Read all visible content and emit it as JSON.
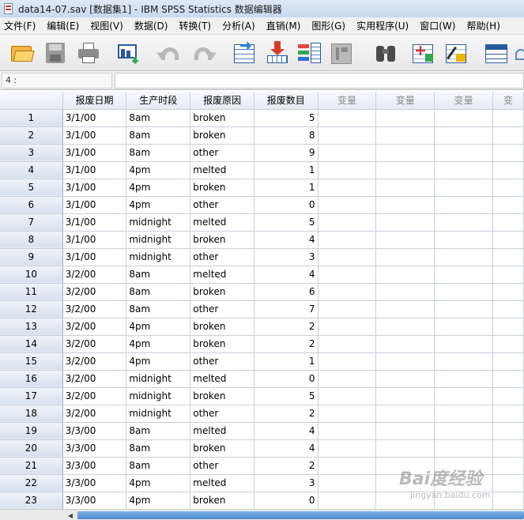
{
  "window": {
    "title": "data14-07.sav [数据集1] - IBM SPSS Statistics 数据编辑器"
  },
  "menu": [
    "文件(F)",
    "编辑(E)",
    "视图(V)",
    "数据(D)",
    "转换(T)",
    "分析(A)",
    "直销(M)",
    "图形(G)",
    "实用程序(U)",
    "窗口(W)",
    "帮助(H)"
  ],
  "toolbar": {
    "buttons": [
      "open-icon",
      "save-icon",
      "print-icon",
      "dialog-recall-icon",
      "undo-icon",
      "redo-icon",
      "goto-case-icon",
      "goto-variable-icon",
      "variables-icon",
      "run-descriptives-icon",
      "find-icon",
      "insert-cases-icon",
      "split-file-icon",
      "value-labels-icon",
      "weight-icon"
    ]
  },
  "cellbar": {
    "reference": "4 :",
    "value": ""
  },
  "grid": {
    "columns": [
      "报废日期",
      "生产时段",
      "报废原因",
      "报废数目",
      "变量",
      "变量",
      "变量",
      "变"
    ],
    "rows": [
      {
        "n": "1",
        "date": "3/1/00",
        "period": "8am",
        "reason": "broken",
        "count": "5"
      },
      {
        "n": "2",
        "date": "3/1/00",
        "period": "8am",
        "reason": "broken",
        "count": "8"
      },
      {
        "n": "3",
        "date": "3/1/00",
        "period": "8am",
        "reason": "other",
        "count": "9"
      },
      {
        "n": "4",
        "date": "3/1/00",
        "period": "4pm",
        "reason": "melted",
        "count": "1"
      },
      {
        "n": "5",
        "date": "3/1/00",
        "period": "4pm",
        "reason": "broken",
        "count": "1"
      },
      {
        "n": "6",
        "date": "3/1/00",
        "period": "4pm",
        "reason": "other",
        "count": "0"
      },
      {
        "n": "7",
        "date": "3/1/00",
        "period": "midnight",
        "reason": "melted",
        "count": "5"
      },
      {
        "n": "8",
        "date": "3/1/00",
        "period": "midnight",
        "reason": "broken",
        "count": "4"
      },
      {
        "n": "9",
        "date": "3/1/00",
        "period": "midnight",
        "reason": "other",
        "count": "3"
      },
      {
        "n": "10",
        "date": "3/2/00",
        "period": "8am",
        "reason": "melted",
        "count": "4"
      },
      {
        "n": "11",
        "date": "3/2/00",
        "period": "8am",
        "reason": "broken",
        "count": "6"
      },
      {
        "n": "12",
        "date": "3/2/00",
        "period": "8am",
        "reason": "other",
        "count": "7"
      },
      {
        "n": "13",
        "date": "3/2/00",
        "period": "4pm",
        "reason": "broken",
        "count": "2"
      },
      {
        "n": "14",
        "date": "3/2/00",
        "period": "4pm",
        "reason": "broken",
        "count": "2"
      },
      {
        "n": "15",
        "date": "3/2/00",
        "period": "4pm",
        "reason": "other",
        "count": "1"
      },
      {
        "n": "16",
        "date": "3/2/00",
        "period": "midnight",
        "reason": "melted",
        "count": "0"
      },
      {
        "n": "17",
        "date": "3/2/00",
        "period": "midnight",
        "reason": "broken",
        "count": "5"
      },
      {
        "n": "18",
        "date": "3/2/00",
        "period": "midnight",
        "reason": "other",
        "count": "2"
      },
      {
        "n": "19",
        "date": "3/3/00",
        "period": "8am",
        "reason": "melted",
        "count": "4"
      },
      {
        "n": "20",
        "date": "3/3/00",
        "period": "8am",
        "reason": "broken",
        "count": "4"
      },
      {
        "n": "21",
        "date": "3/3/00",
        "period": "8am",
        "reason": "other",
        "count": "2"
      },
      {
        "n": "22",
        "date": "3/3/00",
        "period": "4pm",
        "reason": "melted",
        "count": "3"
      },
      {
        "n": "23",
        "date": "3/3/00",
        "period": "4pm",
        "reason": "broken",
        "count": "0"
      }
    ]
  },
  "watermark": {
    "brand": "Bai度经验",
    "url": "jingyan.baidu.com"
  }
}
